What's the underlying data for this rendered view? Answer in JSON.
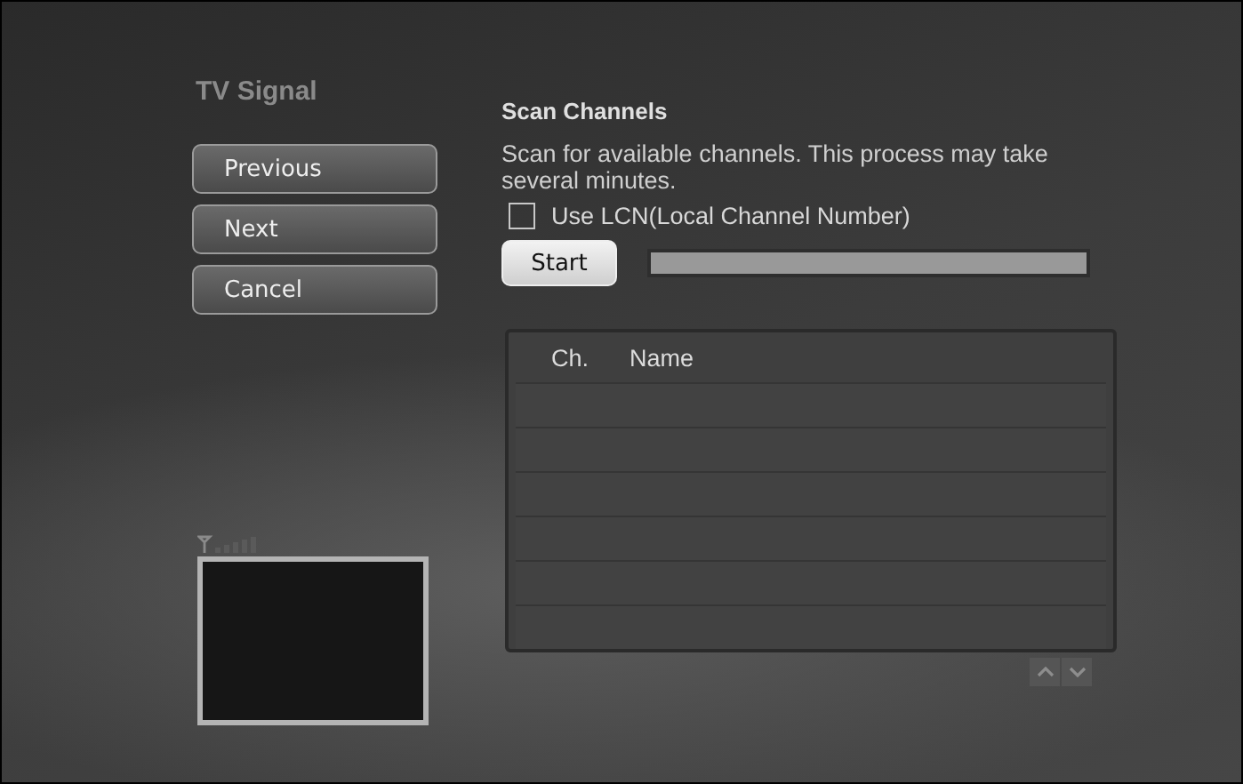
{
  "title": "TV Signal",
  "nav_buttons": [
    {
      "label": "Previous"
    },
    {
      "label": "Next"
    },
    {
      "label": "Cancel"
    }
  ],
  "section_title": "Scan Channels",
  "description": "Scan for available channels. This process may take several minutes.",
  "lcn_checkbox": {
    "label": "Use LCN(Local Channel Number)",
    "checked": false
  },
  "start_button": {
    "label": "Start"
  },
  "scan_progress": {
    "level": 0
  },
  "channel_table": {
    "columns": [
      "Ch.",
      "Name"
    ]
  }
}
